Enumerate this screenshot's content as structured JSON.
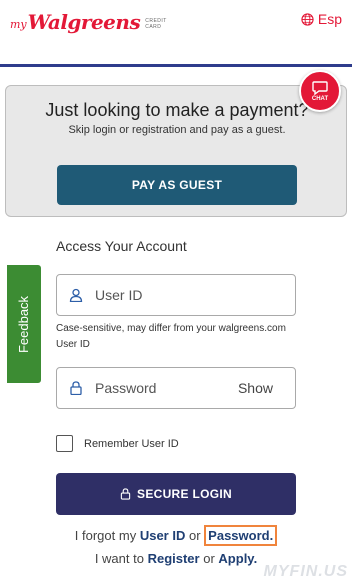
{
  "header": {
    "logo_prefix": "my",
    "logo_brand": "Walgreens",
    "logo_sub": "CREDIT CARD",
    "language_label": "Esp",
    "brand_color": "#e31837"
  },
  "chat": {
    "label": "CHAT"
  },
  "guest": {
    "title": "Just looking to make a payment?",
    "subtitle": "Skip login or registration and pay as a guest.",
    "button_label": "PAY AS GUEST"
  },
  "feedback": {
    "label": "Feedback"
  },
  "account": {
    "heading": "Access Your Account",
    "user_id_placeholder": "User ID",
    "user_id_hint": "Case-sensitive, may differ from your walgreens.com User ID",
    "password_placeholder": "Password",
    "show_label": "Show",
    "remember_label": "Remember User ID",
    "login_button_label": "SECURE LOGIN"
  },
  "links": {
    "forgot_prefix": "I forgot my",
    "user_id_link": "User ID",
    "or_1": "or",
    "password_link": "Password.",
    "want_prefix": "I want to",
    "register_link": "Register",
    "or_2": "or",
    "apply_link": "Apply."
  },
  "watermark": {
    "text": "MYFIN.US"
  }
}
